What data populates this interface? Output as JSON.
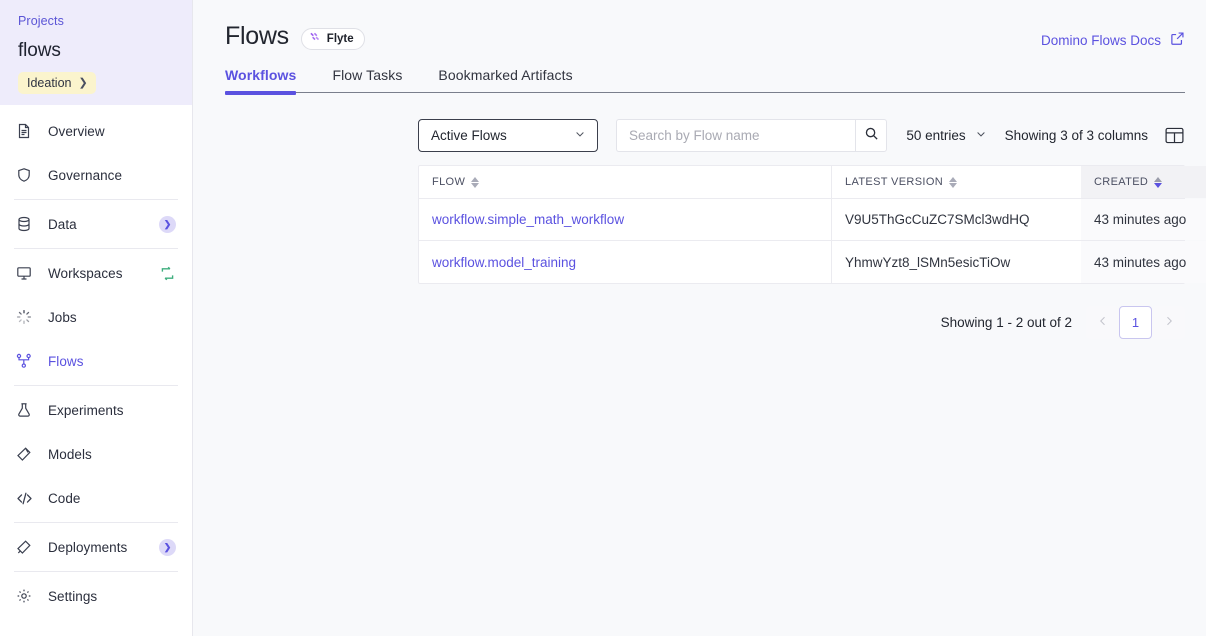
{
  "sidebar": {
    "projects_label": "Projects",
    "project_name": "flows",
    "stage_label": "Ideation",
    "stage_chevron": "chevron-right-icon",
    "items": [
      {
        "label": "Overview",
        "icon": "document-icon",
        "badge": ""
      },
      {
        "label": "Governance",
        "icon": "shield-icon",
        "badge": ""
      },
      {
        "label": "Data",
        "icon": "database-icon",
        "badge": "chevron-right-badge"
      },
      {
        "label": "Workspaces",
        "icon": "monitor-icon",
        "badge": "sync-icon"
      },
      {
        "label": "Jobs",
        "icon": "spinner-icon",
        "badge": ""
      },
      {
        "label": "Flows",
        "icon": "flow-graph-icon",
        "badge": ""
      },
      {
        "label": "Experiments",
        "icon": "flask-icon",
        "badge": ""
      },
      {
        "label": "Models",
        "icon": "model-icon",
        "badge": ""
      },
      {
        "label": "Code",
        "icon": "code-icon",
        "badge": ""
      },
      {
        "label": "Deployments",
        "icon": "deploy-icon",
        "badge": "chevron-right-badge"
      },
      {
        "label": "Settings",
        "icon": "gear-icon",
        "badge": ""
      }
    ]
  },
  "header": {
    "title": "Flows",
    "badge_label": "Flyte",
    "badge_icon": "flyte-logo-icon",
    "docs_link": "Domino Flows Docs",
    "docs_icon": "external-link-icon"
  },
  "tabs": [
    {
      "label": "Workflows"
    },
    {
      "label": "Flow Tasks"
    },
    {
      "label": "Bookmarked Artifacts"
    }
  ],
  "toolbar": {
    "filter_value": "Active Flows",
    "filter_chevron": "chevron-down-icon",
    "search_placeholder": "Search by Flow name",
    "search_value": "",
    "search_icon": "search-icon",
    "entries_label": "50 entries",
    "entries_chevron": "chevron-down-icon",
    "columns_label": "Showing 3 of 3 columns",
    "columns_icon": "columns-layout-icon"
  },
  "table": {
    "columns": [
      {
        "label": "FLOW",
        "sort": "none"
      },
      {
        "label": "LATEST VERSION",
        "sort": "none"
      },
      {
        "label": "CREATED",
        "sort": "desc"
      }
    ],
    "rows": [
      {
        "flow": "workflow.simple_math_workflow",
        "version": "V9U5ThGcCuZC7SMcl3wdHQ",
        "created": "43 minutes ago",
        "menu_icon": "kebab-menu-icon"
      },
      {
        "flow": "workflow.model_training",
        "version": "YhmwYzt8_lSMn5esicTiOw",
        "created": "43 minutes ago",
        "menu_icon": "kebab-menu-icon"
      }
    ]
  },
  "pagination": {
    "summary": "Showing 1 - 2 out of 2",
    "prev_icon": "chevron-left-icon",
    "next_icon": "chevron-right-icon",
    "current_page": "1"
  },
  "colors": {
    "accent": "#5b52e0",
    "sidebar_head_bg": "#eeecfb",
    "stage_badge_bg": "#fbf4cd",
    "main_bg": "#f8f9fb",
    "sync_green": "#3fae7e"
  }
}
